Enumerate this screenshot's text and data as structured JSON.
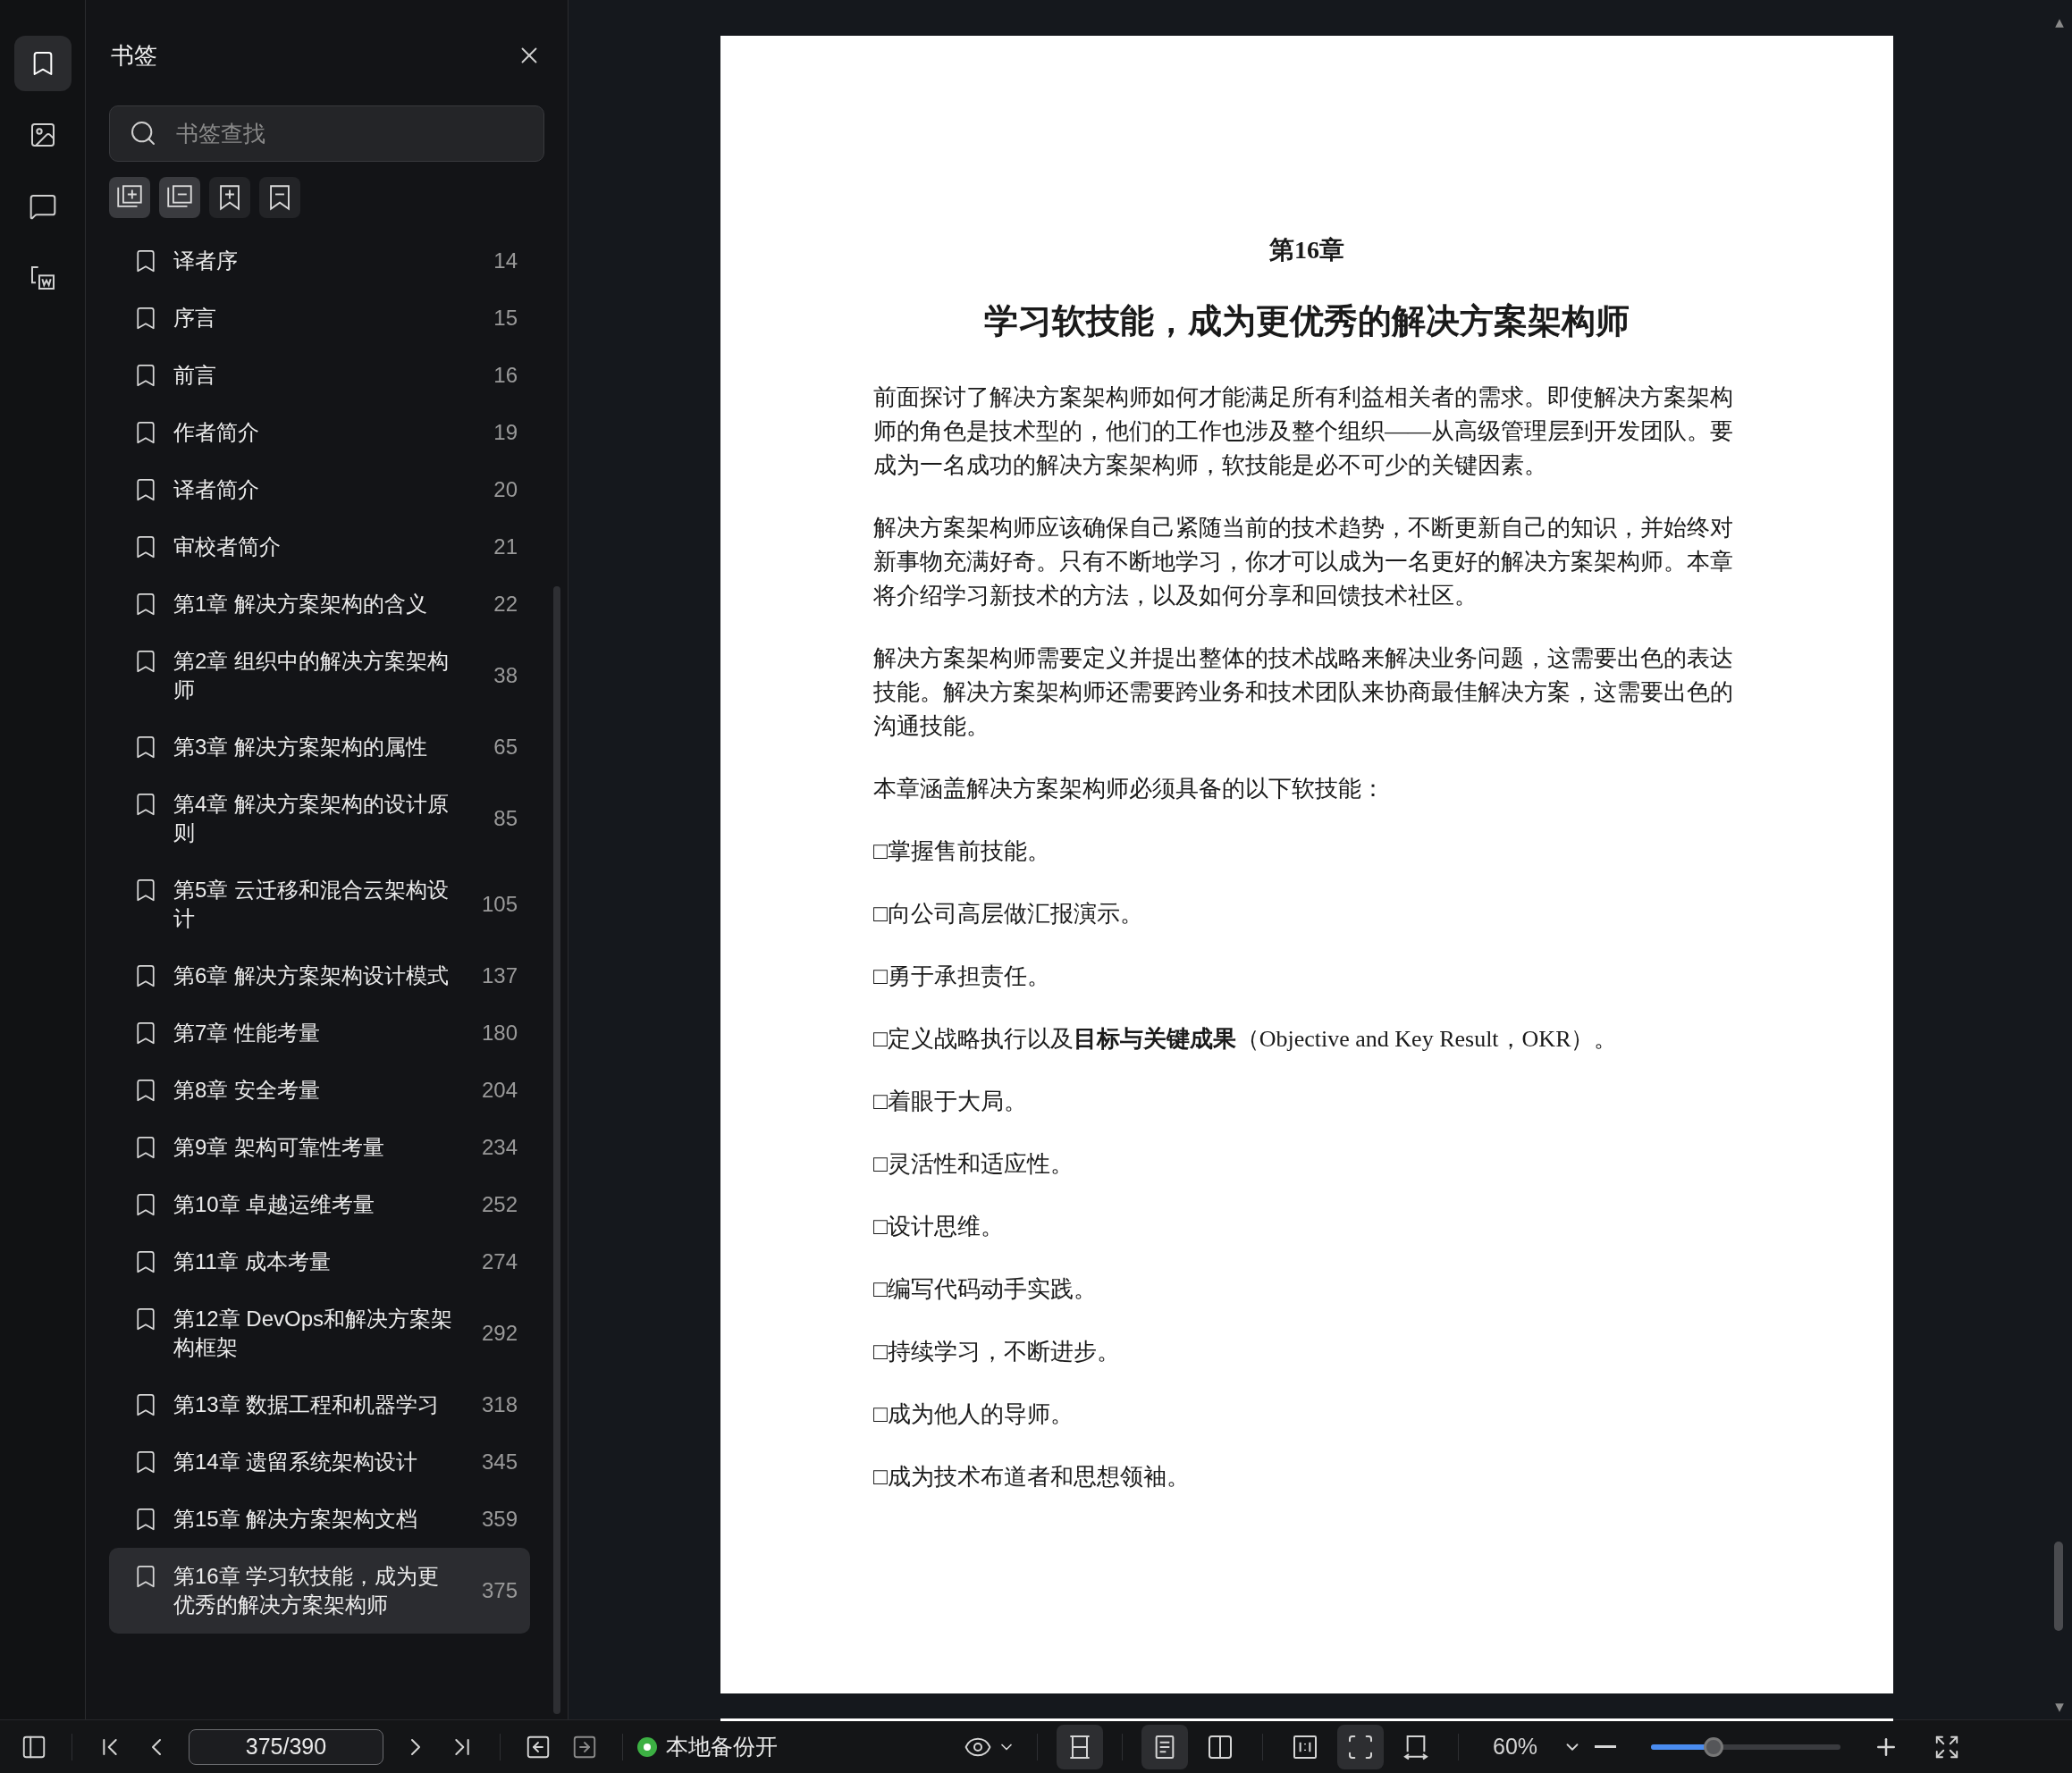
{
  "rail": [
    {
      "kind": "bookmarks",
      "selected": true
    },
    {
      "kind": "thumbnails",
      "selected": false
    },
    {
      "kind": "comments",
      "selected": false
    },
    {
      "kind": "convert",
      "selected": false
    }
  ],
  "sidebar": {
    "title": "书签",
    "search": {
      "placeholder": "书签查找"
    },
    "tools": [
      {
        "kind": "expand_all",
        "highlighted": true
      },
      {
        "kind": "collapse_all",
        "highlighted": true
      },
      {
        "kind": "add",
        "highlighted": false
      },
      {
        "kind": "remove",
        "highlighted": false
      }
    ],
    "bookmarks": [
      {
        "title": "译者序",
        "page": "14",
        "selected": false
      },
      {
        "title": "序言",
        "page": "15",
        "selected": false
      },
      {
        "title": "前言",
        "page": "16",
        "selected": false
      },
      {
        "title": "作者简介",
        "page": "19",
        "selected": false
      },
      {
        "title": "译者简介",
        "page": "20",
        "selected": false
      },
      {
        "title": "审校者简介",
        "page": "21",
        "selected": false
      },
      {
        "title": "第1章 解决方案架构的含义",
        "page": "22",
        "selected": false
      },
      {
        "title": "第2章 组织中的解决方案架构师",
        "page": "38",
        "selected": false
      },
      {
        "title": "第3章 解决方案架构的属性",
        "page": "65",
        "selected": false
      },
      {
        "title": "第4章 解决方案架构的设计原则",
        "page": "85",
        "selected": false
      },
      {
        "title": "第5章 云迁移和混合云架构设计",
        "page": "105",
        "selected": false
      },
      {
        "title": "第6章 解决方案架构设计模式",
        "page": "137",
        "selected": false
      },
      {
        "title": "第7章 性能考量",
        "page": "180",
        "selected": false
      },
      {
        "title": "第8章 安全考量",
        "page": "204",
        "selected": false
      },
      {
        "title": "第9章 架构可靠性考量",
        "page": "234",
        "selected": false
      },
      {
        "title": "第10章 卓越运维考量",
        "page": "252",
        "selected": false
      },
      {
        "title": "第11章 成本考量",
        "page": "274",
        "selected": false
      },
      {
        "title": "第12章 DevOps和解决方案架构框架",
        "page": "292",
        "selected": false
      },
      {
        "title": "第13章 数据工程和机器学习",
        "page": "318",
        "selected": false
      },
      {
        "title": "第14章 遗留系统架构设计",
        "page": "345",
        "selected": false
      },
      {
        "title": "第15章 解决方案架构文档",
        "page": "359",
        "selected": false
      },
      {
        "title": "第16章 学习软技能，成为更优秀的解决方案架构师",
        "page": "375",
        "selected": true
      }
    ]
  },
  "document": {
    "chapter": "第16章",
    "title": "学习软技能，成为更优秀的解决方案架构师",
    "paragraphs": [
      "前面探讨了解决方案架构师如何才能满足所有利益相关者的需求。即使解决方案架构师的角色是技术型的，他们的工作也涉及整个组织——从高级管理层到开发团队。要成为一名成功的解决方案架构师，软技能是必不可少的关键因素。",
      "解决方案架构师应该确保自己紧随当前的技术趋势，不断更新自己的知识，并始终对新事物充满好奇。只有不断地学习，你才可以成为一名更好的解决方案架构师。本章将介绍学习新技术的方法，以及如何分享和回馈技术社区。",
      "解决方案架构师需要定义并提出整体的技术战略来解决业务问题，这需要出色的表达技能。解决方案架构师还需要跨业务和技术团队来协商最佳解决方案，这需要出色的沟通技能。",
      "本章涵盖解决方案架构师必须具备的以下软技能：",
      "□掌握售前技能。",
      "□向公司高层做汇报演示。",
      "□勇于承担责任。",
      "□定义战略执行以及**目标与关键成果**（Objective and Key Result，OKR）。",
      "□着眼于大局。",
      "□灵活性和适应性。",
      "□设计思维。",
      "□编写代码动手实践。",
      "□持续学习，不断进步。",
      "□成为他人的导师。",
      "□成为技术布道者和思想领袖。"
    ]
  },
  "toolbar": {
    "page_field": {
      "value": "375/390"
    },
    "backup": {
      "label": "本地备份开",
      "on": true
    },
    "view_modes": [
      {
        "kind": "continuous",
        "selected": true
      },
      {
        "kind": "single",
        "selected": true
      },
      {
        "kind": "double",
        "selected": false
      },
      {
        "kind": "fit_width",
        "selected": false
      },
      {
        "kind": "fit_page",
        "selected": true
      },
      {
        "kind": "rotate",
        "selected": false
      }
    ],
    "zoom": {
      "value": "60%",
      "level": 0.33
    }
  }
}
